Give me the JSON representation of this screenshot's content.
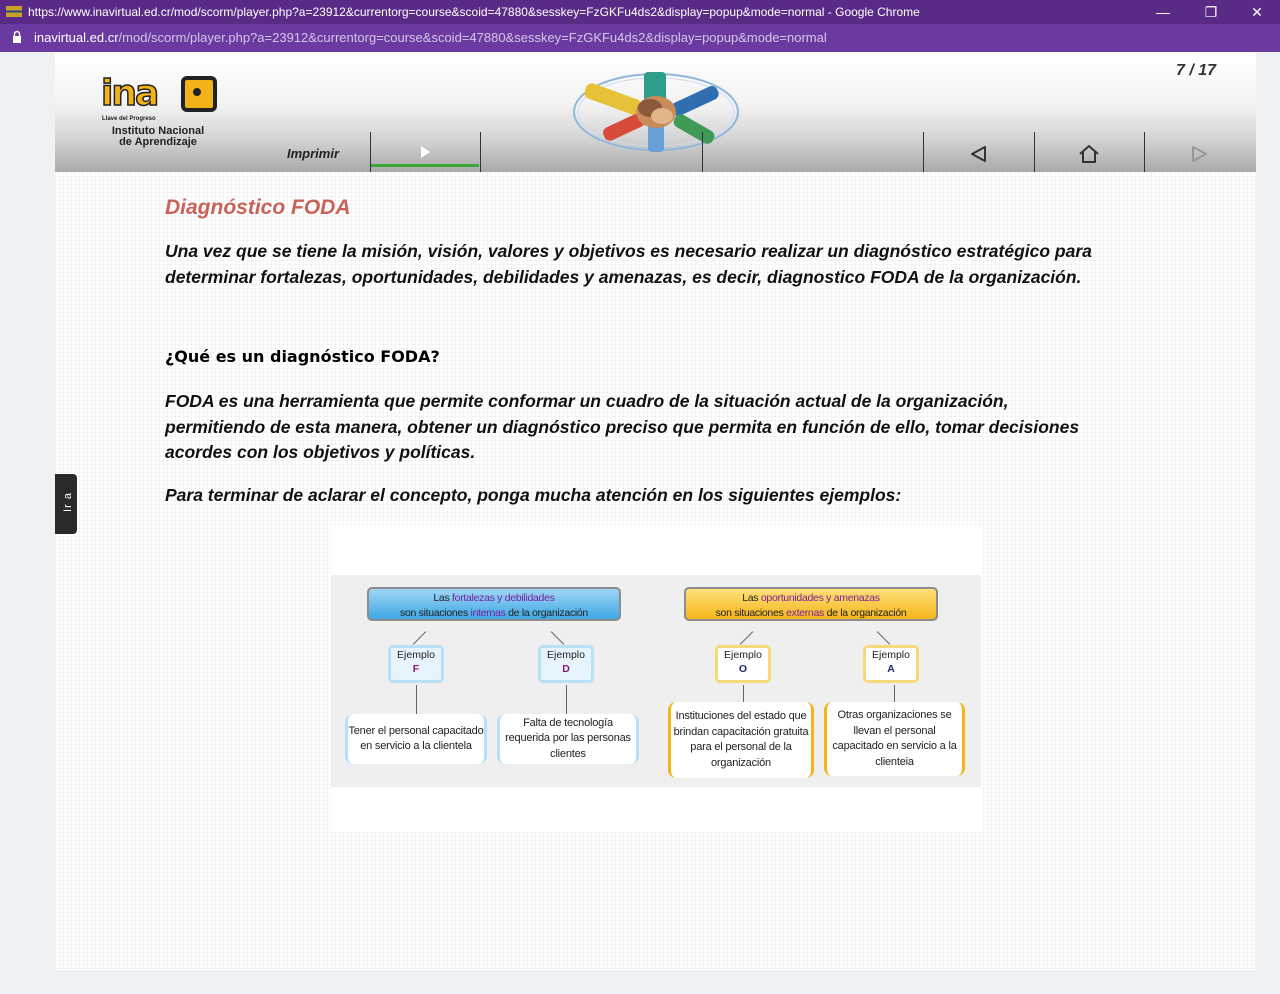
{
  "browser": {
    "title": "https://www.inavirtual.ed.cr/mod/scorm/player.php?a=23912&currentorg=course&scoid=47880&sesskey=FzGKFu4ds2&display=popup&mode=normal - Google Chrome",
    "url_domain": "inavirtual.ed.cr",
    "url_path": "/mod/scorm/player.php?a=23912&currentorg=course&scoid=47880&sesskey=FzGKFu4ds2&display=popup&mode=normal",
    "controls": {
      "minimize": "—",
      "restore": "❐",
      "close": "✕"
    }
  },
  "header": {
    "logo_word": "ina",
    "logo_tagline": "Llave del Progreso",
    "logo_name_line1": "Instituto Nacional",
    "logo_name_line2": "de Aprendizaje",
    "page_counter": "7 / 17",
    "print_label": "Imprimir",
    "icons": {
      "play": "play-icon",
      "back": "back-arrow-icon",
      "home": "home-icon",
      "next": "next-arrow-icon"
    }
  },
  "side_tab": {
    "label": "Ir a"
  },
  "content": {
    "title": "Diagnóstico FODA",
    "intro_line1": "Una vez que se tiene la misión, visión, valores y objetivos es necesario realizar un diagnóstico estratégico para",
    "intro_line2": "determinar fortalezas, oportunidades, debilidades y amenazas, es decir, diagnostico FODA de la organización.",
    "question": "¿Qué es un diagnóstico FODA?",
    "def_line1": "FODA es una herramienta que permite conformar un cuadro de la situación actual de la organización,",
    "def_line2": "permitiendo de esta manera, obtener un diagnóstico preciso que permita en función de ello, tomar decisiones",
    "def_line3": "acordes con los objetivos y políticas.",
    "closing": "Para terminar de aclarar el concepto, ponga mucha atención en los siguientes ejemplos:"
  },
  "diagram": {
    "left_header": {
      "pre": "Las ",
      "hl": "fortalezas y debilidades",
      "line2_pre": "son situaciones ",
      "line2_hl": "internas",
      "line2_post": " de la organización"
    },
    "right_header": {
      "pre": "Las ",
      "hl": "oportunidades y amenazas",
      "line2_pre": "son situaciones ",
      "line2_hl": "externas",
      "line2_post": " de la organización"
    },
    "example_label": "Ejemplo",
    "letters": {
      "f": "F",
      "d": "D",
      "o": "O",
      "a": "A"
    },
    "examples": {
      "f": "Tener el personal capacitado en servicio a la clientela",
      "d": "Falta de tecnología requerida por las personas clientes",
      "o": "Instituciones del estado que brindan capacitación gratuita para el personal de la organización",
      "a": "Otras organizaciones se llevan el personal capacitado en servicio a la  clienteia"
    }
  }
}
